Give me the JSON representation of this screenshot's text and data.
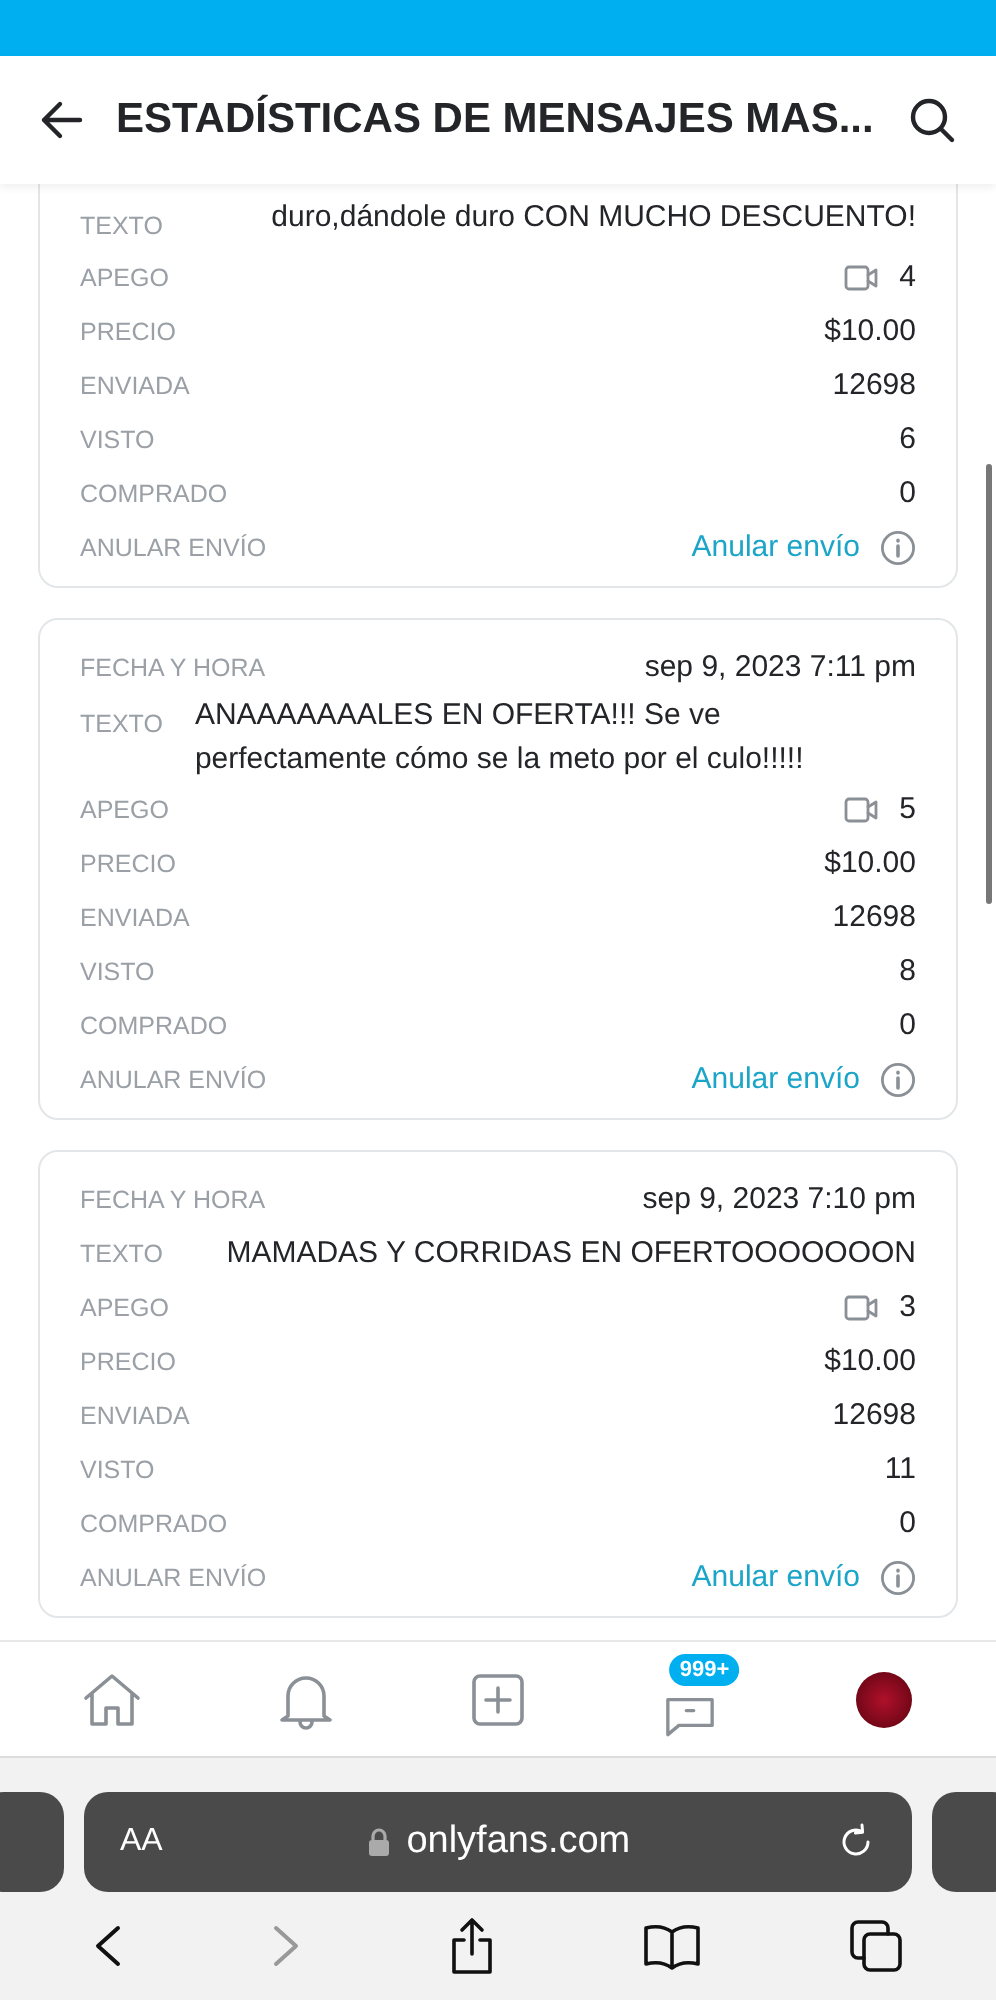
{
  "header": {
    "title": "ESTADÍSTICAS DE MENSAJES MAS..."
  },
  "cards": [
    {
      "rows": [
        {
          "kind": "text",
          "label": "TEXTO",
          "value": "duro,dándole duro CON MUCHO DESCUENTO!"
        },
        {
          "kind": "media",
          "label": "APEGO",
          "value": "4"
        },
        {
          "kind": "plain",
          "label": "PRECIO",
          "value": "$10.00"
        },
        {
          "kind": "plain",
          "label": "ENVIADA",
          "value": "12698"
        },
        {
          "kind": "plain",
          "label": "VISTO",
          "value": "6"
        },
        {
          "kind": "plain",
          "label": "COMPRADO",
          "value": "0"
        },
        {
          "kind": "link",
          "label": "ANULAR ENVÍO",
          "value": "Anular envío"
        }
      ]
    },
    {
      "rows": [
        {
          "kind": "plain",
          "label": "FECHA Y HORA",
          "value": "sep 9, 2023 7:11 pm"
        },
        {
          "kind": "text",
          "label": "TEXTO",
          "value": "ANAAAAAAALES EN OFERTA!!! Se ve perfectamente cómo se la meto por el culo!!!!!"
        },
        {
          "kind": "media",
          "label": "APEGO",
          "value": "5"
        },
        {
          "kind": "plain",
          "label": "PRECIO",
          "value": "$10.00"
        },
        {
          "kind": "plain",
          "label": "ENVIADA",
          "value": "12698"
        },
        {
          "kind": "plain",
          "label": "VISTO",
          "value": "8"
        },
        {
          "kind": "plain",
          "label": "COMPRADO",
          "value": "0"
        },
        {
          "kind": "link",
          "label": "ANULAR ENVÍO",
          "value": "Anular envío"
        }
      ]
    },
    {
      "rows": [
        {
          "kind": "plain",
          "label": "FECHA Y HORA",
          "value": "sep 9, 2023 7:10 pm"
        },
        {
          "kind": "plain",
          "label": "TEXTO",
          "value": "MAMADAS Y CORRIDAS EN OFERTOOOOOOON"
        },
        {
          "kind": "media",
          "label": "APEGO",
          "value": "3"
        },
        {
          "kind": "plain",
          "label": "PRECIO",
          "value": "$10.00"
        },
        {
          "kind": "plain",
          "label": "ENVIADA",
          "value": "12698"
        },
        {
          "kind": "plain",
          "label": "VISTO",
          "value": "11"
        },
        {
          "kind": "plain",
          "label": "COMPRADO",
          "value": "0"
        },
        {
          "kind": "link",
          "label": "ANULAR ENVÍO",
          "value": "Anular envío"
        }
      ]
    }
  ],
  "nav": {
    "badge": "999+"
  },
  "browser": {
    "text_size": "AA",
    "url": "onlyfans.com"
  }
}
